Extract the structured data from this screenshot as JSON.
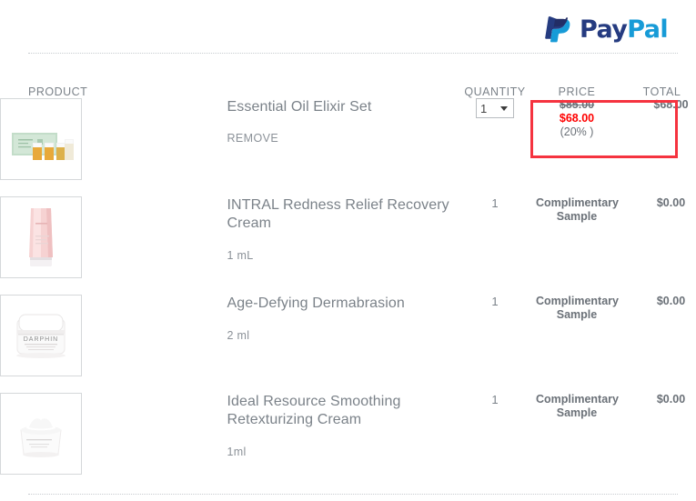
{
  "brand": {
    "logo_name": "paypal-logo",
    "word_part1": "Pay",
    "word_part2": "Pal",
    "color_dark": "#253b80",
    "color_light": "#179bd7"
  },
  "table": {
    "headers": {
      "product": "PRODUCT",
      "quantity": "QUANTITY",
      "price": "PRICE",
      "total": "TOTAL"
    },
    "rows": [
      {
        "name": "Essential Oil Elixir Set",
        "action_label": "REMOVE",
        "sub_label": "",
        "quantity_value": "1",
        "quantity_is_select": true,
        "price_original": "$85.00",
        "price_discounted": "$68.00",
        "price_percent": "(20% )",
        "price_plain": "",
        "total": "$68.00",
        "thumb": "essential-oil-elixir-set-thumbnail"
      },
      {
        "name": "INTRAL Redness Relief Recovery Cream",
        "action_label": "",
        "sub_label": "1 mL",
        "quantity_value": "1",
        "quantity_is_select": false,
        "price_original": "",
        "price_discounted": "",
        "price_percent": "",
        "price_plain": "Complimentary Sample",
        "total": "$0.00",
        "thumb": "intral-redness-relief-cream-thumbnail"
      },
      {
        "name": "Age-Defying Dermabrasion",
        "action_label": "",
        "sub_label": "2 ml",
        "quantity_value": "1",
        "quantity_is_select": false,
        "price_original": "",
        "price_discounted": "",
        "price_percent": "",
        "price_plain": "Complimentary Sample",
        "total": "$0.00",
        "thumb": "age-defying-dermabrasion-thumbnail"
      },
      {
        "name": "Ideal Resource Smoothing Retexturizing Cream",
        "action_label": "",
        "sub_label": "1ml",
        "quantity_value": "1",
        "quantity_is_select": false,
        "price_original": "",
        "price_discounted": "",
        "price_percent": "",
        "price_plain": "Complimentary Sample",
        "total": "$0.00",
        "thumb": "ideal-resource-smoothing-cream-thumbnail"
      }
    ]
  },
  "annotation": {
    "highlight_color": "#f5333f",
    "discount_text_color": "#ff0000"
  }
}
